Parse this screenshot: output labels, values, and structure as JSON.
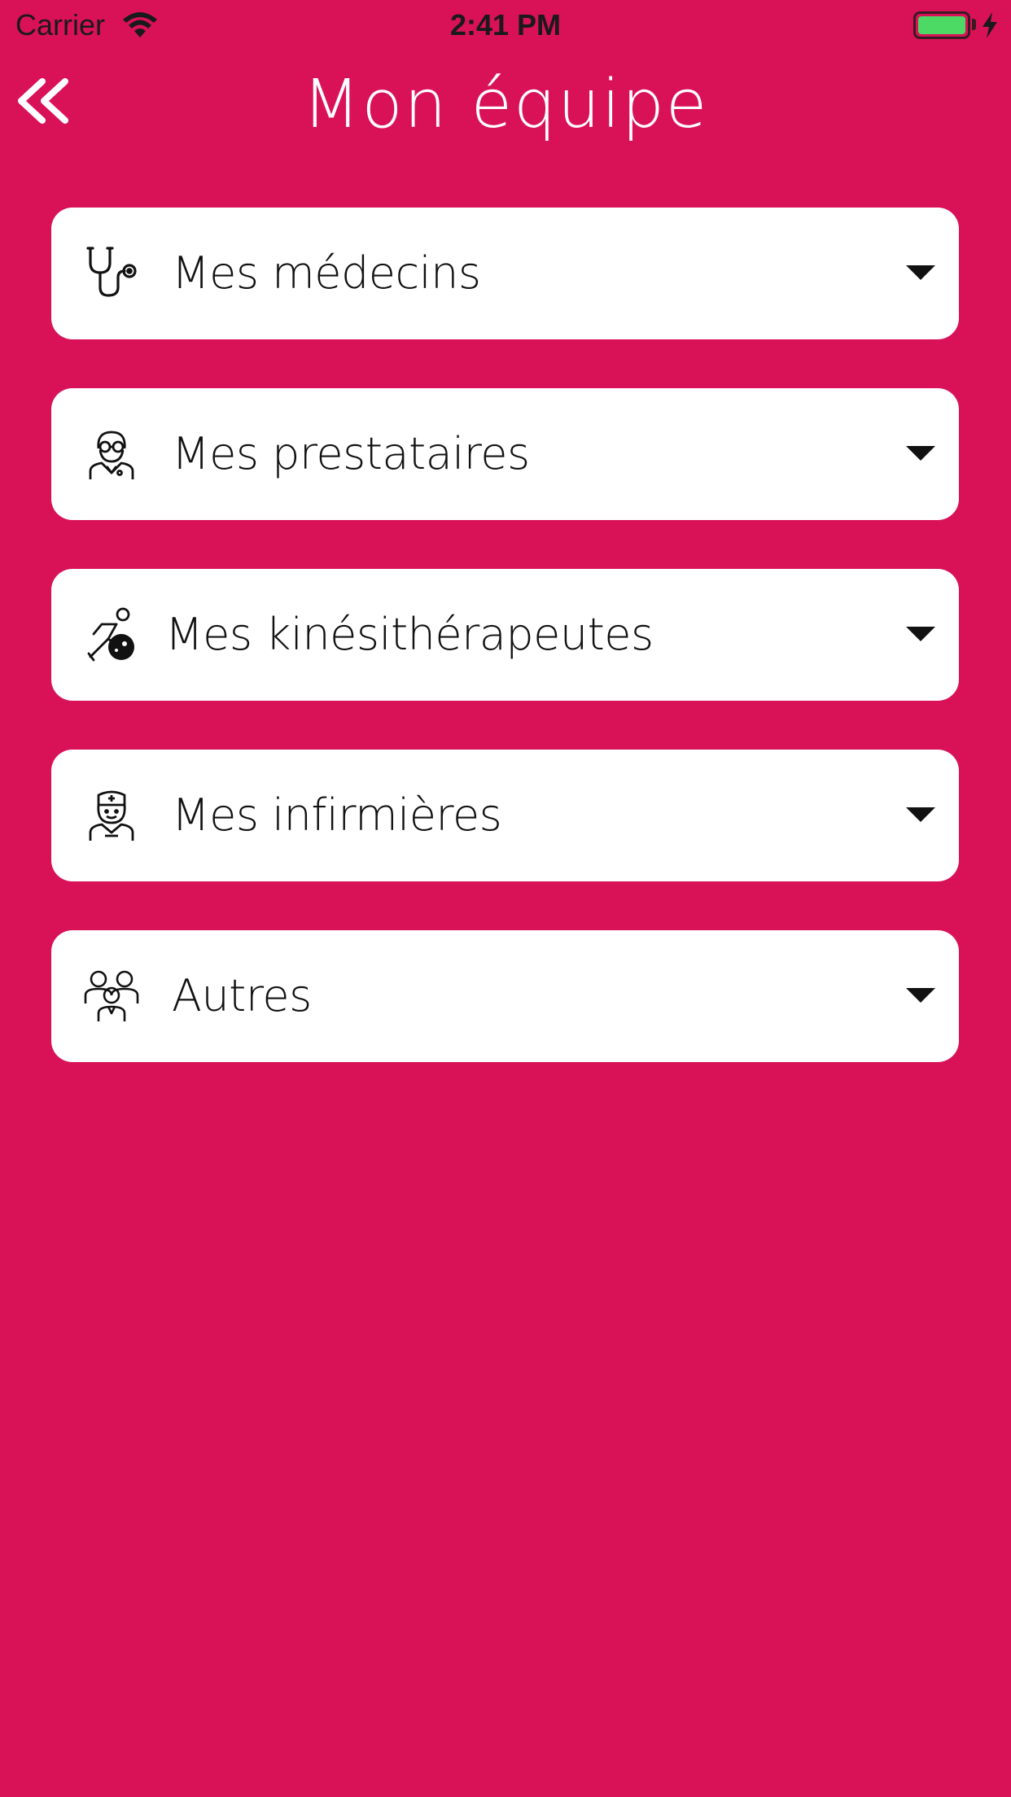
{
  "status_bar": {
    "carrier": "Carrier",
    "time": "2:41 PM",
    "battery_color": "#4CD964"
  },
  "header": {
    "title": "Mon équipe",
    "back_icon": "double-chevron-left-icon"
  },
  "theme": {
    "background": "#D91257",
    "card_background": "#FFFFFF",
    "title_color": "#FFFFFF"
  },
  "sections": [
    {
      "label": "Mes médecins",
      "icon": "stethoscope-icon"
    },
    {
      "label": "Mes prestataires",
      "icon": "doctor-glasses-icon"
    },
    {
      "label": "Mes kinésithérapeutes",
      "icon": "physiotherapy-ball-icon"
    },
    {
      "label": "Mes infirmières",
      "icon": "nurse-icon"
    },
    {
      "label": "Autres",
      "icon": "group-people-icon"
    }
  ]
}
